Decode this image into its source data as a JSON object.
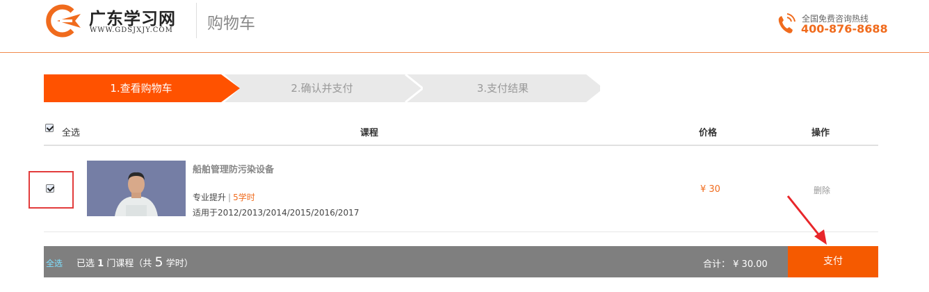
{
  "header": {
    "brand_name": "广东学习网",
    "brand_url": "WWW.GDSJXJY.COM",
    "page_title": "购物车",
    "hotline_label": "全国免费咨询热线",
    "hotline_number": "400-876-8688",
    "accent_color": "#f06b1d"
  },
  "steps": [
    {
      "label": "1.查看购物车",
      "active": true
    },
    {
      "label": "2.确认并支付",
      "active": false
    },
    {
      "label": "3.支付结果",
      "active": false
    }
  ],
  "table": {
    "select_all_label": "全选",
    "columns": [
      "课程",
      "价格",
      "操作"
    ],
    "select_all_checked": true
  },
  "items": [
    {
      "checked": true,
      "title": "船舶管理防污染设备",
      "category": "专业提升",
      "separator": "|",
      "hours": "5学时",
      "years": "适用于2012/2013/2014/2015/2016/2017",
      "price": "¥ 30",
      "action": "删除"
    }
  ],
  "footer": {
    "select_all_label": "全选",
    "selected_prefix": "已选",
    "selected_count": "1",
    "selected_mid": "门课程（共",
    "total_hours": "5",
    "hours_suffix": "学时）",
    "total_label": "合计：",
    "total_value": "¥  30.00",
    "pay_label": "支付",
    "pay_color": "#f55a00"
  },
  "icons": [
    "logo-icon",
    "phone-icon",
    "checkbox-icon",
    "arrow-annotation-icon"
  ]
}
